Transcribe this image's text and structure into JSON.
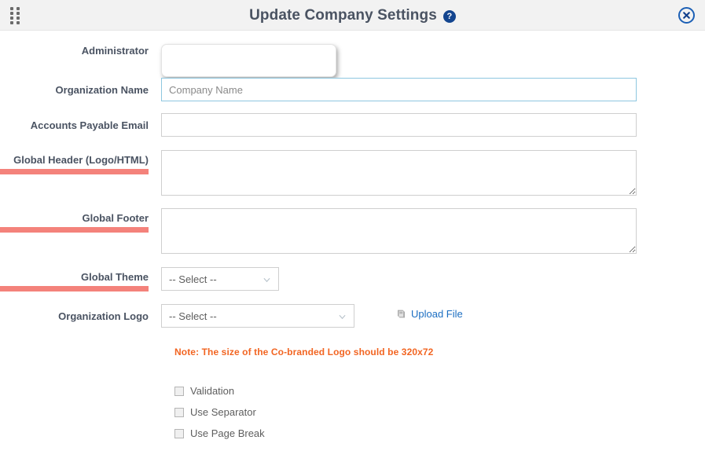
{
  "header": {
    "title": "Update Company Settings",
    "help_icon": "question-circle-icon",
    "help_glyph": "?",
    "close_icon": "close-circle-icon",
    "drag_handle_icon": "drag-dots-icon",
    "background": "#f2f2f2",
    "title_color": "#4a5362",
    "help_color": "#13458f",
    "close_color": "#1b5fb5"
  },
  "form": {
    "fields": [
      {
        "label": "Administrator",
        "type": "popover-box",
        "value": "",
        "placeholder": "",
        "underlined": false
      },
      {
        "label": "Organization Name",
        "type": "text",
        "value": "Company Name",
        "placeholder": "Company Name",
        "underlined": false,
        "focused": true
      },
      {
        "label": "Accounts Payable Email",
        "type": "text",
        "value": "",
        "placeholder": "",
        "underlined": false
      },
      {
        "label": "Global Header (Logo/HTML)",
        "type": "textarea",
        "value": "",
        "placeholder": "",
        "underlined": true
      },
      {
        "label": "Global Footer",
        "type": "textarea",
        "value": "",
        "placeholder": "",
        "underlined": true
      },
      {
        "label": "Global Theme",
        "type": "select",
        "value": "-- Select --",
        "underlined": true
      },
      {
        "label": "Organization Logo",
        "type": "select",
        "value": "-- Select --",
        "underlined": false
      }
    ],
    "select_placeholder": "-- Select --",
    "upload": {
      "label": "Upload File",
      "icon": "upload-file-icon",
      "color": "#1b6ec2"
    },
    "note": {
      "text": "Note: The size of the Co-branded Logo should be 320x72",
      "color": "#f26522"
    },
    "checkboxes": [
      {
        "label": "Validation",
        "checked": false
      },
      {
        "label": "Use Separator",
        "checked": false
      },
      {
        "label": "Use Page Break",
        "checked": false
      }
    ],
    "label_color": "#4a5362",
    "underline_color": "#f4827b",
    "input_border": "#cfcfcf",
    "focused_border": "#8ec7e0"
  }
}
